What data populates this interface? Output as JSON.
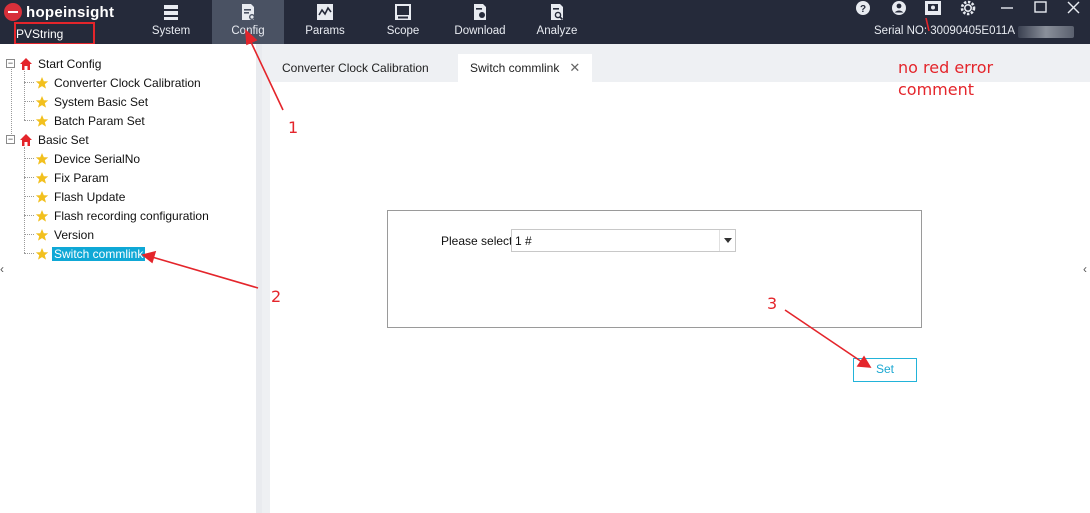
{
  "app": {
    "logo_text": "hopeinsight",
    "product_label": "PVString",
    "serial_label": "Serial NO: 30090405E011A"
  },
  "nav": {
    "tabs": [
      {
        "label": "System",
        "icon": "server-icon",
        "active": false
      },
      {
        "label": "Config",
        "icon": "config-doc-icon",
        "active": true
      },
      {
        "label": "Params",
        "icon": "params-chart-icon",
        "active": false
      },
      {
        "label": "Scope",
        "icon": "scope-icon",
        "active": false
      },
      {
        "label": "Download",
        "icon": "download-icon",
        "active": false
      },
      {
        "label": "Analyze",
        "icon": "analyze-icon",
        "active": false
      }
    ]
  },
  "titlebar_icons": [
    "help-icon",
    "user-icon",
    "screenshot-icon",
    "settings-icon",
    "minimize-icon",
    "maximize-icon",
    "close-icon"
  ],
  "tree": {
    "groups": [
      {
        "label": "Start Config",
        "expander": "−",
        "icon": "home-icon",
        "items": [
          {
            "label": "Converter Clock Calibration",
            "icon": "star-icon"
          },
          {
            "label": "System Basic Set",
            "icon": "star-icon"
          },
          {
            "label": "Batch Param Set",
            "icon": "star-icon"
          }
        ]
      },
      {
        "label": "Basic Set",
        "expander": "−",
        "icon": "home-icon",
        "items": [
          {
            "label": "Device SerialNo",
            "icon": "star-icon"
          },
          {
            "label": "Fix Param",
            "icon": "star-icon"
          },
          {
            "label": "Flash Update",
            "icon": "star-icon"
          },
          {
            "label": "Flash recording configuration",
            "icon": "star-icon"
          },
          {
            "label": "Version",
            "icon": "star-icon"
          },
          {
            "label": "Switch commlink",
            "icon": "star-icon",
            "selected": true
          }
        ]
      }
    ]
  },
  "tabs": [
    {
      "label": "Converter Clock Calibration",
      "active": false
    },
    {
      "label": "Switch commlink",
      "active": true,
      "close": "✕"
    }
  ],
  "form": {
    "select_label": "Please select",
    "select_value": "1 #",
    "set_button": "Set"
  },
  "annotations": {
    "step1": "1",
    "step2": "2",
    "step3": "3",
    "note": "no red error\ncomment"
  },
  "colors": {
    "topbar": "#252a3a",
    "active_tab": "#4a5263",
    "selection": "#0fa8d6",
    "annotation": "#e4252b",
    "button_border": "#22b3d9"
  }
}
